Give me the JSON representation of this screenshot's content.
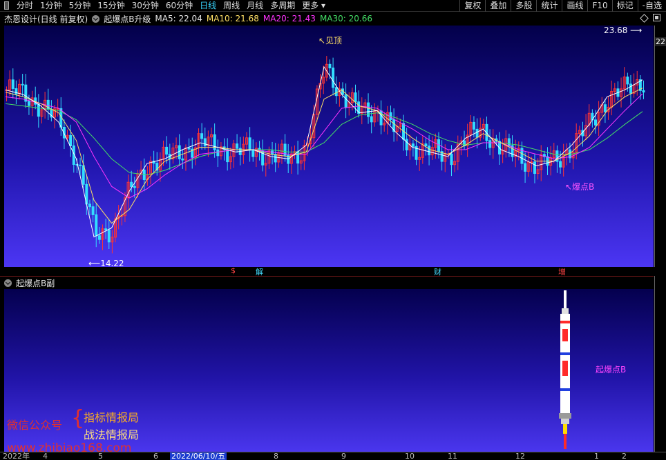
{
  "toolbar": {
    "periods": [
      "分时",
      "1分钟",
      "5分钟",
      "15分钟",
      "30分钟",
      "60分钟",
      "日线",
      "周线",
      "月线",
      "多周期",
      "更多"
    ],
    "active_period": "日线",
    "right_buttons": [
      "复权",
      "叠加",
      "多股",
      "统计",
      "画线",
      "F10",
      "标记",
      "-自选"
    ]
  },
  "main_panel": {
    "title": "杰恩设计(日线 前复权)",
    "indicator": "起爆点B升级",
    "ma5": "MA5: 22.04",
    "ma10": "MA10: 21.68",
    "ma20": "MA20: 21.43",
    "ma30": "MA30: 20.66",
    "axis_tag": "22",
    "annotations": {
      "high_label": "23.68",
      "low_label": "14.22",
      "top_label": "见顶",
      "signal_label": "爆点B"
    },
    "colors": {
      "ma5": "#ffffff",
      "ma10": "#ffe066",
      "ma20": "#ff33ff",
      "ma30": "#44dd66",
      "up": "#ff3333",
      "down": "#33ddff"
    }
  },
  "events": [
    {
      "label": "$",
      "color": "#ff4444"
    },
    {
      "label": "解",
      "color": "#44ddff"
    },
    {
      "label": "财",
      "color": "#44ddff"
    },
    {
      "label": "增",
      "color": "#ff4444"
    }
  ],
  "sub_panel": {
    "title": "起爆点B副",
    "signal_label": "起爆点B"
  },
  "date_axis": {
    "labels": [
      "2022年",
      "4",
      "5",
      "6",
      "2022/06/10/五",
      "8",
      "9",
      "10",
      "11",
      "12",
      "1",
      "2"
    ],
    "cursor_label": "2022/06/10/五"
  },
  "watermark": {
    "wechat": "微信公众号",
    "line1": "指标情报局",
    "line2": "战法情报局",
    "url": "www.zhibiao168.com"
  },
  "chart_data": {
    "type": "candlestick",
    "title": "杰恩设计(日线 前复权)",
    "x_range": [
      "2022-03",
      "2023-02"
    ],
    "y_range": [
      14.22,
      23.68
    ],
    "series": [
      {
        "name": "MA5",
        "values": [
          21.6,
          21.4,
          20.9,
          20.2,
          18.6,
          15.2,
          15.6,
          17.2,
          18.4,
          18.6,
          19.0,
          19.3,
          19.1,
          18.9,
          19.0,
          18.7,
          18.6,
          19.2,
          22.6,
          21.4,
          20.6,
          20.7,
          19.8,
          19.1,
          18.9,
          18.7,
          19.5,
          19.9,
          19.0,
          18.7,
          18.3,
          18.5,
          19.2,
          20.1,
          21.3,
          21.6,
          22.04
        ]
      },
      {
        "name": "MA10",
        "values": [
          21.5,
          21.3,
          21.0,
          20.6,
          19.4,
          16.8,
          15.8,
          16.4,
          17.7,
          18.5,
          18.8,
          19.1,
          19.1,
          19.0,
          19.0,
          18.8,
          18.7,
          18.9,
          21.2,
          21.6,
          20.9,
          20.7,
          20.1,
          19.5,
          19.0,
          18.8,
          19.2,
          19.7,
          19.3,
          18.9,
          18.5,
          18.5,
          18.9,
          19.6,
          20.7,
          21.3,
          21.68
        ]
      },
      {
        "name": "MA20",
        "values": [
          21.3,
          21.2,
          21.0,
          20.8,
          20.2,
          18.7,
          17.4,
          16.9,
          17.3,
          17.9,
          18.4,
          18.8,
          18.9,
          19.0,
          19.0,
          18.9,
          18.8,
          18.8,
          19.8,
          20.8,
          20.9,
          20.8,
          20.3,
          19.9,
          19.4,
          19.0,
          19.0,
          19.3,
          19.3,
          19.0,
          18.8,
          18.6,
          18.7,
          19.1,
          19.9,
          20.7,
          21.43
        ]
      },
      {
        "name": "MA30",
        "values": [
          21.0,
          20.9,
          20.8,
          20.7,
          20.3,
          19.5,
          18.6,
          18.0,
          17.9,
          18.1,
          18.4,
          18.7,
          18.9,
          19.0,
          19.0,
          19.0,
          18.9,
          18.9,
          19.3,
          20.1,
          20.5,
          20.6,
          20.4,
          20.1,
          19.7,
          19.4,
          19.2,
          19.3,
          19.3,
          19.2,
          19.0,
          18.8,
          18.8,
          19.0,
          19.5,
          20.1,
          20.66
        ]
      }
    ]
  }
}
